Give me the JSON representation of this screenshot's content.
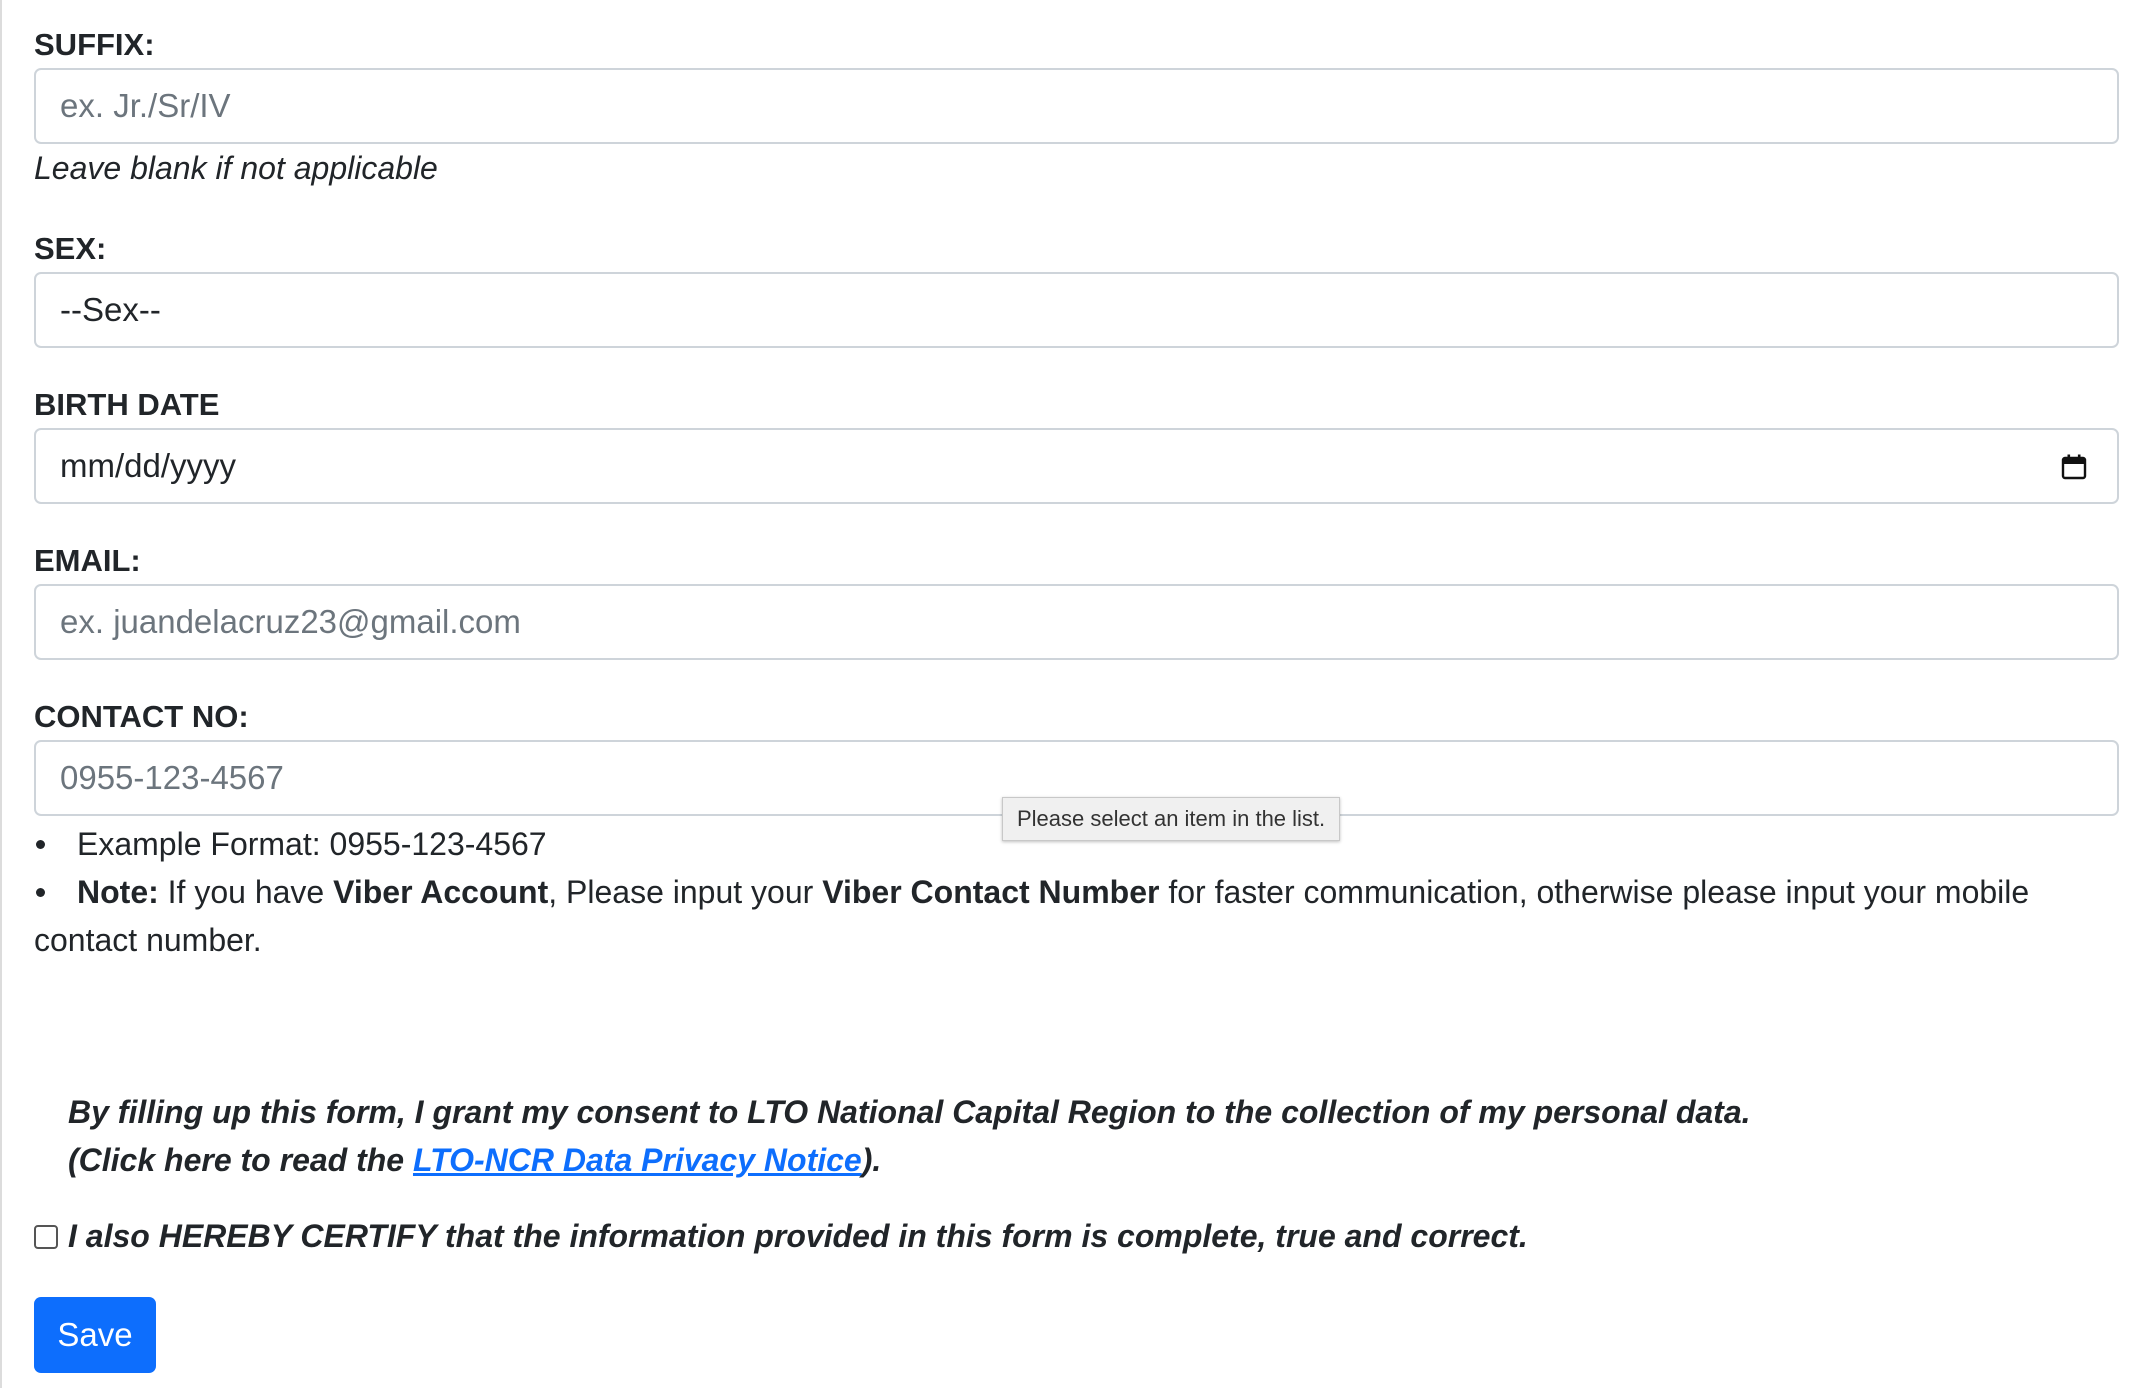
{
  "form": {
    "suffix": {
      "label": "SUFFIX:",
      "placeholder": "ex. Jr./Sr/IV",
      "help": "Leave blank if not applicable"
    },
    "sex": {
      "label": "SEX:",
      "selected": "--Sex--"
    },
    "birth_date": {
      "label": "BIRTH DATE",
      "placeholder": "mm/dd/yyyy",
      "icon": "calendar-icon"
    },
    "email": {
      "label": "EMAIL:",
      "placeholder": "ex. juandelacruz23@gmail.com"
    },
    "contact": {
      "label": "CONTACT NO:",
      "placeholder": "0955-123-4567",
      "example_format": "Example Format: 0955-123-4567",
      "note": {
        "label": "Note:",
        "text1": " If you have ",
        "bold1": "Viber Account",
        "text2": ", Please input your ",
        "bold2": "Viber Contact Number",
        "text3": " for faster communication, otherwise please input your mobile contact number."
      }
    },
    "tooltip": "Please select an item in the list.",
    "consent": {
      "line1": "By filling up this form, I grant my consent to LTO National Capital Region to the collection of my personal data.",
      "line2_prefix": "(Click here to read the ",
      "link_text": "LTO-NCR Data Privacy Notice",
      "line2_suffix": ")."
    },
    "certify": {
      "label": "I also HEREBY CERTIFY that the information provided in this form is complete, true and correct.",
      "checked": false
    },
    "save_label": "Save",
    "colors": {
      "primary": "#0d6efd",
      "border": "#ced4da",
      "placeholder": "#6c757d",
      "text": "#212529"
    }
  }
}
